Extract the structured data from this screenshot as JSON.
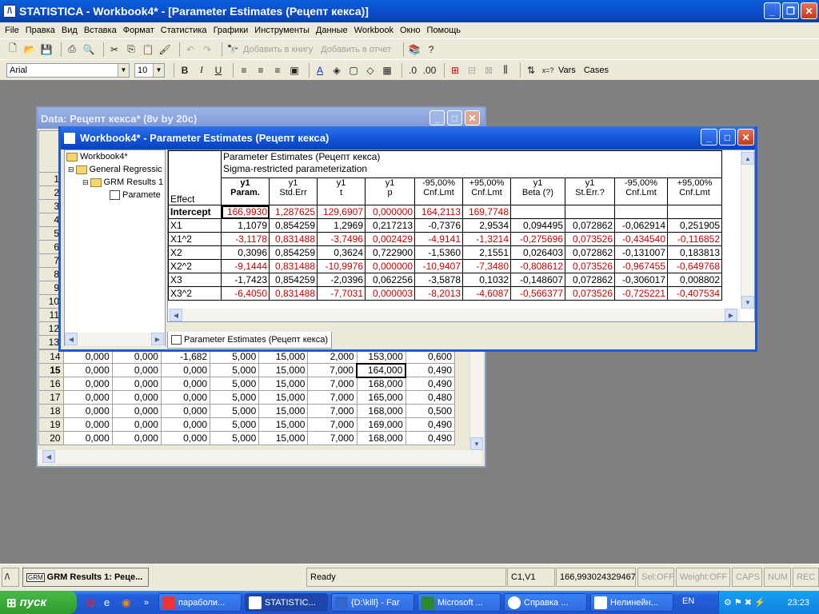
{
  "app": {
    "title": "STATISTICA - Workbook4* - [Parameter Estimates (Рецепт кекса)]"
  },
  "menu": [
    "File",
    "Правка",
    "Вид",
    "Вставка",
    "Формат",
    "Статистика",
    "Графики",
    "Инструменты",
    "Данные",
    "Workbook",
    "Окно",
    "Помощь"
  ],
  "toolbar": {
    "add_to_workbook": "Добавить в книгу",
    "add_to_report": "Добавить в отчет",
    "font_name": "Arial",
    "font_size": "10",
    "bold": "B",
    "italic": "I",
    "underline": "U",
    "vars": "Vars",
    "cases": "Cases"
  },
  "data_window": {
    "title": "Data: Рецепт кекса* (8v by 20c)",
    "row_numbers_partial": [
      "1",
      "2",
      "3",
      "4",
      "5",
      "6",
      "7",
      "8",
      "9",
      "10",
      "11",
      "12",
      "13"
    ],
    "rows": [
      {
        "n": "14",
        "v": [
          "0,000",
          "0,000",
          "-1,682",
          "5,000",
          "15,000",
          "2,000",
          "153,000",
          "0,600"
        ]
      },
      {
        "n": "15",
        "v": [
          "0,000",
          "0,000",
          "0,000",
          "5,000",
          "15,000",
          "7,000",
          "164,000",
          "0,490"
        ]
      },
      {
        "n": "16",
        "v": [
          "0,000",
          "0,000",
          "0,000",
          "5,000",
          "15,000",
          "7,000",
          "168,000",
          "0,490"
        ]
      },
      {
        "n": "17",
        "v": [
          "0,000",
          "0,000",
          "0,000",
          "5,000",
          "15,000",
          "7,000",
          "165,000",
          "0,480"
        ]
      },
      {
        "n": "18",
        "v": [
          "0,000",
          "0,000",
          "0,000",
          "5,000",
          "15,000",
          "7,000",
          "168,000",
          "0,500"
        ]
      },
      {
        "n": "19",
        "v": [
          "0,000",
          "0,000",
          "0,000",
          "5,000",
          "15,000",
          "7,000",
          "169,000",
          "0,490"
        ]
      },
      {
        "n": "20",
        "v": [
          "0,000",
          "0,000",
          "0,000",
          "5,000",
          "15,000",
          "7,000",
          "168,000",
          "0,490"
        ]
      }
    ]
  },
  "workbook_window": {
    "title": "Workbook4* - Parameter Estimates (Рецепт кекса)",
    "tree": [
      "Workbook4*",
      "General Regressic",
      "GRM Results 1",
      "Paramete"
    ],
    "sheet_tab": "Parameter Estimates (Рецепт кекса)",
    "report_title": "Parameter Estimates (Рецепт кекса)",
    "report_subtitle": "Sigma-restricted parameterization",
    "effect_header": "Effect",
    "columns": [
      {
        "top": "y1",
        "bottom": "Param."
      },
      {
        "top": "y1",
        "bottom": "Std.Err"
      },
      {
        "top": "y1",
        "bottom": "t"
      },
      {
        "top": "y1",
        "bottom": "p"
      },
      {
        "top": "-95,00%",
        "bottom": "Cnf.Lmt"
      },
      {
        "top": "+95,00%",
        "bottom": "Cnf.Lmt"
      },
      {
        "top": "y1",
        "bottom": "Beta (?)"
      },
      {
        "top": "y1",
        "bottom": "St.Err.?"
      },
      {
        "top": "-95,00%",
        "bottom": "Cnf.Lmt"
      },
      {
        "top": "+95,00%",
        "bottom": "Cnf.Lmt"
      }
    ],
    "rows": [
      {
        "effect": "Intercept",
        "red": true,
        "bold": true,
        "v": [
          "166,9930",
          "1,287625",
          "129,6907",
          "0,000000",
          "164,2113",
          "169,7748",
          "",
          "",
          "",
          ""
        ]
      },
      {
        "effect": "X1",
        "red": false,
        "v": [
          "1,1079",
          "0,854259",
          "1,2969",
          "0,217213",
          "-0,7376",
          "2,9534",
          "0,094495",
          "0,072862",
          "-0,062914",
          "0,251905"
        ]
      },
      {
        "effect": "X1^2",
        "red": true,
        "v": [
          "-3,1178",
          "0,831488",
          "-3,7496",
          "0,002429",
          "-4,9141",
          "-1,3214",
          "-0,275696",
          "0,073526",
          "-0,434540",
          "-0,116852"
        ]
      },
      {
        "effect": "X2",
        "red": false,
        "v": [
          "0,3096",
          "0,854259",
          "0,3624",
          "0,722900",
          "-1,5360",
          "2,1551",
          "0,026403",
          "0,072862",
          "-0,131007",
          "0,183813"
        ]
      },
      {
        "effect": "X2^2",
        "red": true,
        "v": [
          "-9,1444",
          "0,831488",
          "-10,9976",
          "0,000000",
          "-10,9407",
          "-7,3480",
          "-0,808612",
          "0,073526",
          "-0,967455",
          "-0,649768"
        ]
      },
      {
        "effect": "X3",
        "red": false,
        "v": [
          "-1,7423",
          "0,854259",
          "-2,0396",
          "0,062256",
          "-3,5878",
          "0,1032",
          "-0,148607",
          "0,072862",
          "-0,306017",
          "0,008802"
        ]
      },
      {
        "effect": "X3^2",
        "red": true,
        "v": [
          "-6,4050",
          "0,831488",
          "-7,7031",
          "0,000003",
          "-8,2013",
          "-4,6087",
          "-0,566377",
          "0,073526",
          "-0,725221",
          "-0,407534"
        ]
      }
    ]
  },
  "statusbar": {
    "results_button": "GRM Results 1: Реце...",
    "ready": "Ready",
    "cell": "C1,V1",
    "value": "166,993024329467",
    "sel": "Sel:OFF",
    "weight": "Weight:OFF",
    "caps": "CAPS",
    "num": "NUM",
    "rec": "REC"
  },
  "taskbar": {
    "start": "пуск",
    "items": [
      "параболи...",
      "STATISTIC...",
      "{D:\\kill} - Far",
      "Microsoft ...",
      "Справка ...",
      "Нелинейн..."
    ],
    "lang": "EN",
    "clock": "23:23"
  },
  "colors": {
    "highlight_red": "#d00000",
    "xp_blue": "#0b4bc8"
  }
}
